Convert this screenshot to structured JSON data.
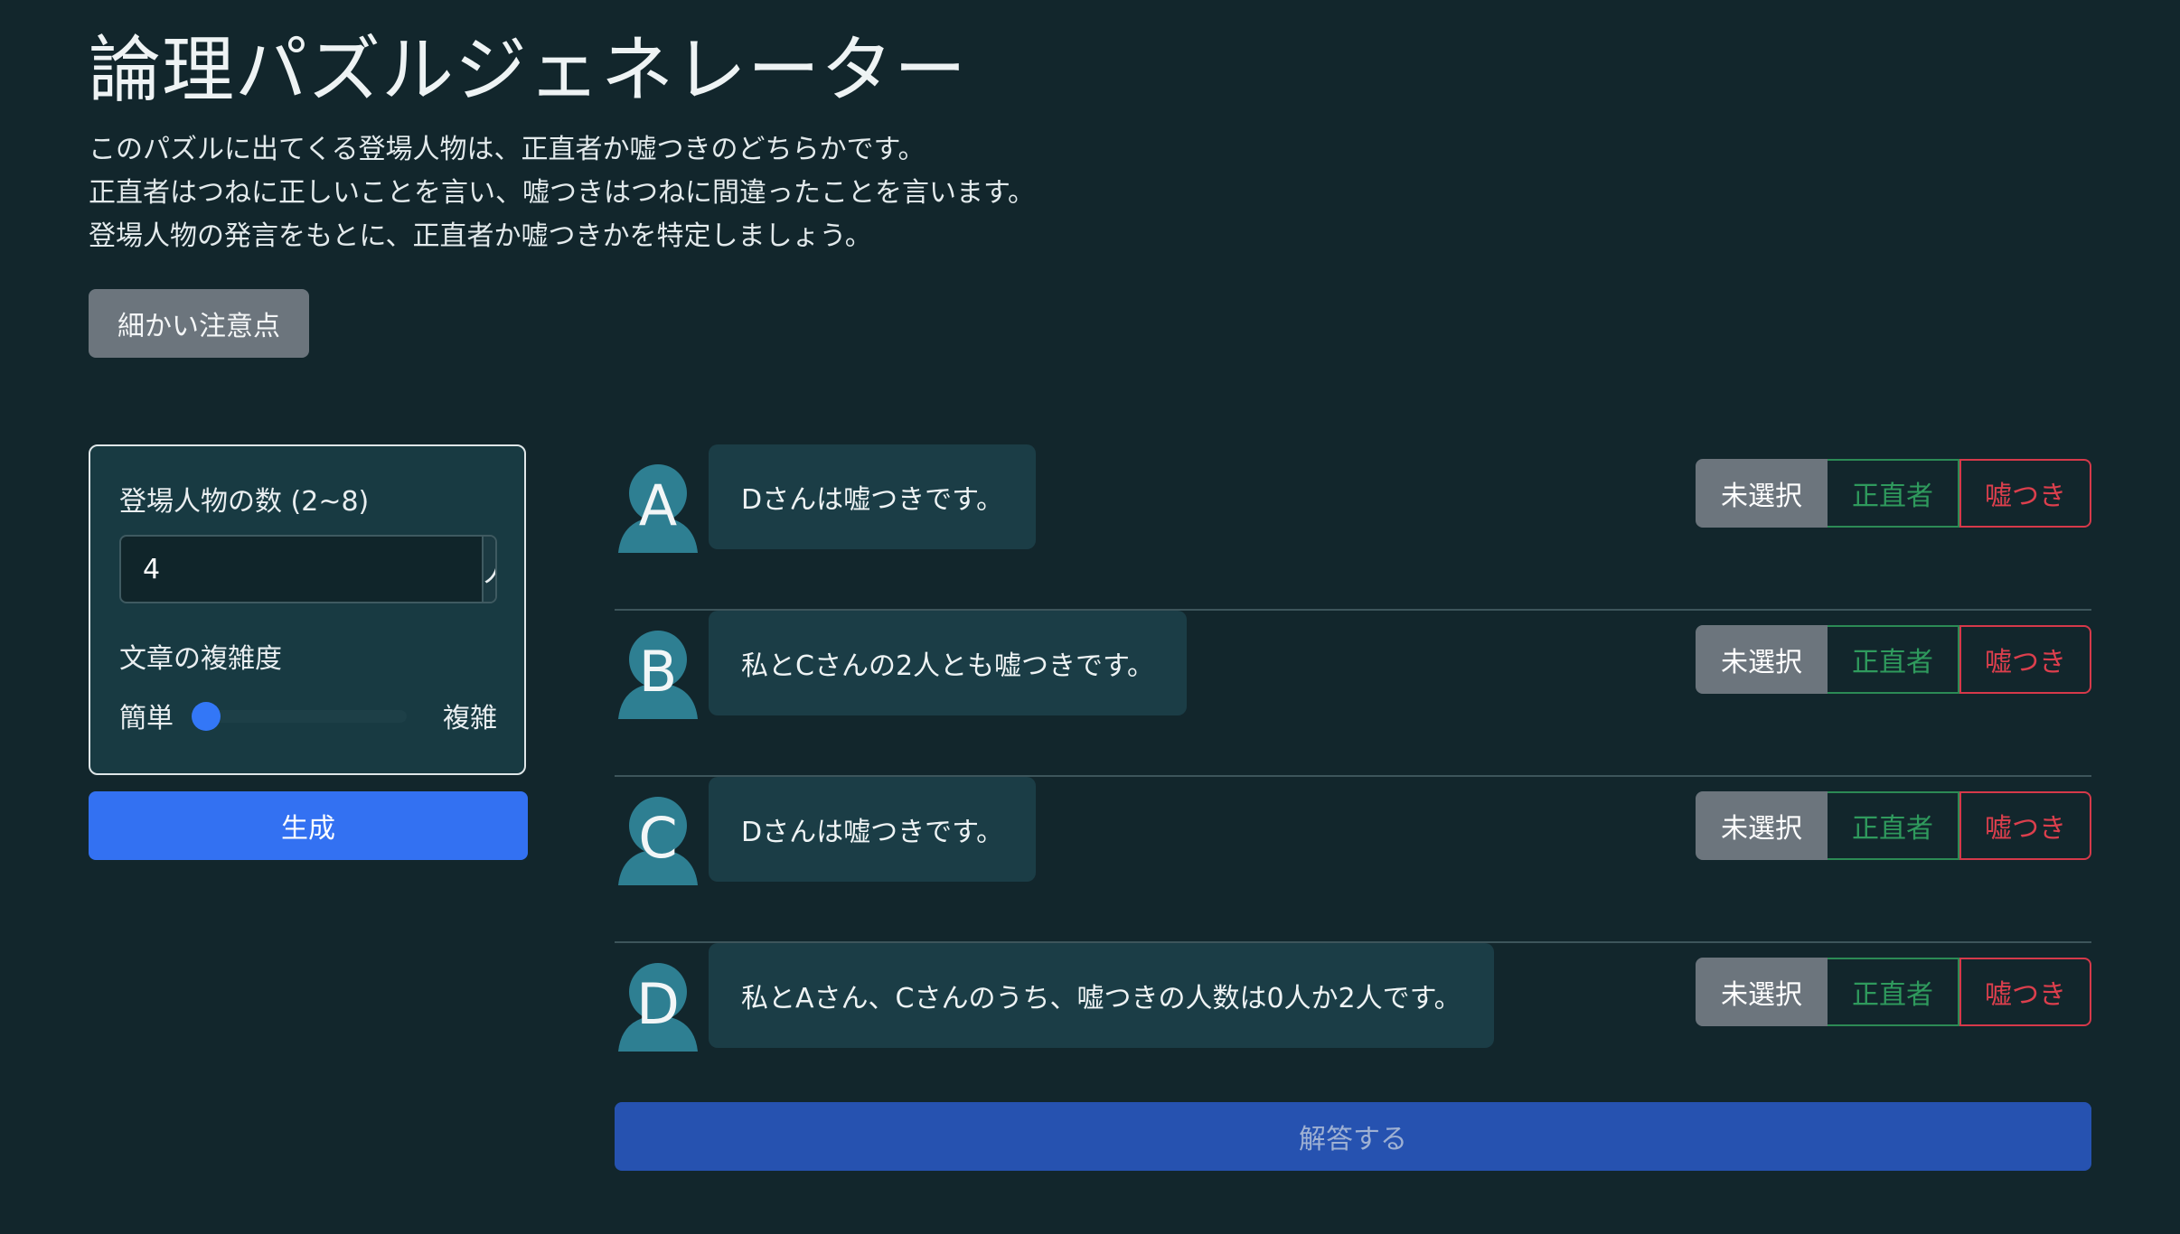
{
  "header": {
    "title": "論理パズルジェネレーター",
    "description": [
      "このパズルに出てくる登場人物は、正直者か嘘つきのどちらかです。",
      "正直者はつねに正しいことを言い、嘘つきはつねに間違ったことを言います。",
      "登場人物の発言をもとに、正直者か嘘つきかを特定しましょう。"
    ],
    "notes_button": "細かい注意点"
  },
  "settings": {
    "count_label": "登場人物の数 (2~8)",
    "count_value": "4",
    "count_unit": "人",
    "complexity_label": "文章の複雑度",
    "complexity_min_label": "簡単",
    "complexity_max_label": "複雑",
    "complexity_level": 0,
    "generate_button": "生成"
  },
  "statements": [
    {
      "speaker": "A",
      "text": "Dさんは嘘つきです。",
      "choices": [
        "未選択",
        "正直者",
        "嘘つき"
      ],
      "selected": "未選択"
    },
    {
      "speaker": "B",
      "text": "私とCさんの2人とも嘘つきです。",
      "choices": [
        "未選択",
        "正直者",
        "嘘つき"
      ],
      "selected": "未選択"
    },
    {
      "speaker": "C",
      "text": "Dさんは嘘つきです。",
      "choices": [
        "未選択",
        "正直者",
        "嘘つき"
      ],
      "selected": "未選択"
    },
    {
      "speaker": "D",
      "text": "私とAさん、Cさんのうち、嘘つきの人数は0人か2人です。",
      "choices": [
        "未選択",
        "正直者",
        "嘘つき"
      ],
      "selected": "未選択"
    }
  ],
  "answer_button": "解答する",
  "colors": {
    "background": "#12262c",
    "primary": "#3371f2",
    "honest": "#2f9a5d",
    "liar": "#dc3f4d",
    "secondary": "#6c757d"
  }
}
